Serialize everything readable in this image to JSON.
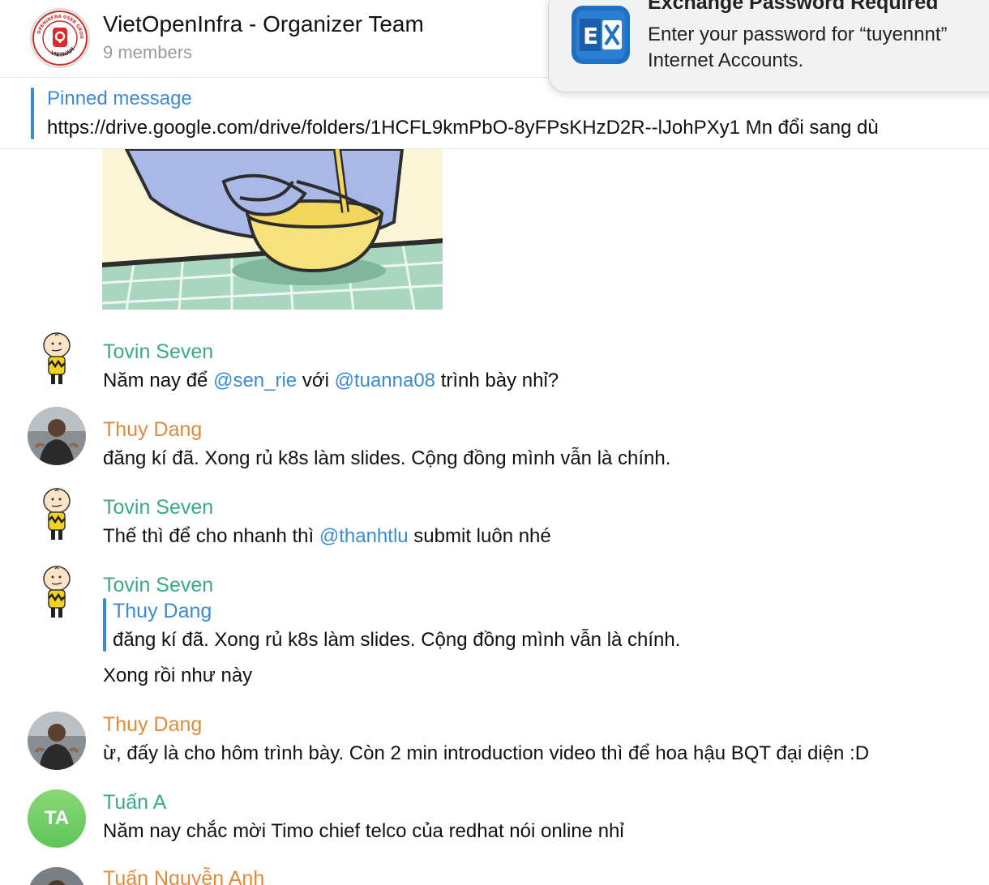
{
  "header": {
    "title": "VietOpenInfra - Organizer Team",
    "members": "9 members",
    "avatar_text_top": "OPENINFRA USER GROUP",
    "avatar_text_bottom": "VIETNAM"
  },
  "notification": {
    "title": "Exchange Password Required",
    "body_line1": "Enter your password for “tuyennnt”",
    "body_line2": "Internet Accounts.",
    "icon": "exchange-icon"
  },
  "pinned": {
    "title": "Pinned message",
    "text": "https://drive.google.com/drive/folders/1HCFL9kmPbO-8yFPsKHzD2R--lJohPXy1  Mn đổi sang dù"
  },
  "messages": [
    {
      "sender": "Tovin Seven",
      "parts": [
        "Năm nay để ",
        "@sen_rie",
        " với ",
        "@tuanna08",
        " trình bày nhỉ?"
      ]
    },
    {
      "sender": "Thuy Dang",
      "text": "đăng kí đã. Xong rủ k8s làm slides. Cộng đồng mình vẫn là chính."
    },
    {
      "sender": "Tovin Seven",
      "parts": [
        "Thế thì để cho nhanh thì ",
        "@thanhtlu",
        " submit luôn nhé"
      ]
    },
    {
      "sender": "Tovin Seven",
      "reply_name": "Thuy Dang",
      "reply_text": "đăng kí đã. Xong rủ k8s làm slides. Cộng đồng mình vẫn là chính.",
      "text": "Xong rồi như này"
    },
    {
      "sender": "Thuy Dang",
      "text": "ừ, đấy là cho hôm trình bày. Còn 2 min introduction video thì để hoa hậu BQT đại diện :D"
    },
    {
      "sender": "Tuấn A",
      "initials": "TA",
      "text": "Năm nay chắc mời Timo chief telco của redhat nói online nhỉ"
    },
    {
      "sender": "Tuấn Nguyễn Anh"
    }
  ],
  "colors": {
    "accent": "#3a8ad6",
    "sender_green": "#3aa98a",
    "sender_orange": "#e08a3c"
  }
}
